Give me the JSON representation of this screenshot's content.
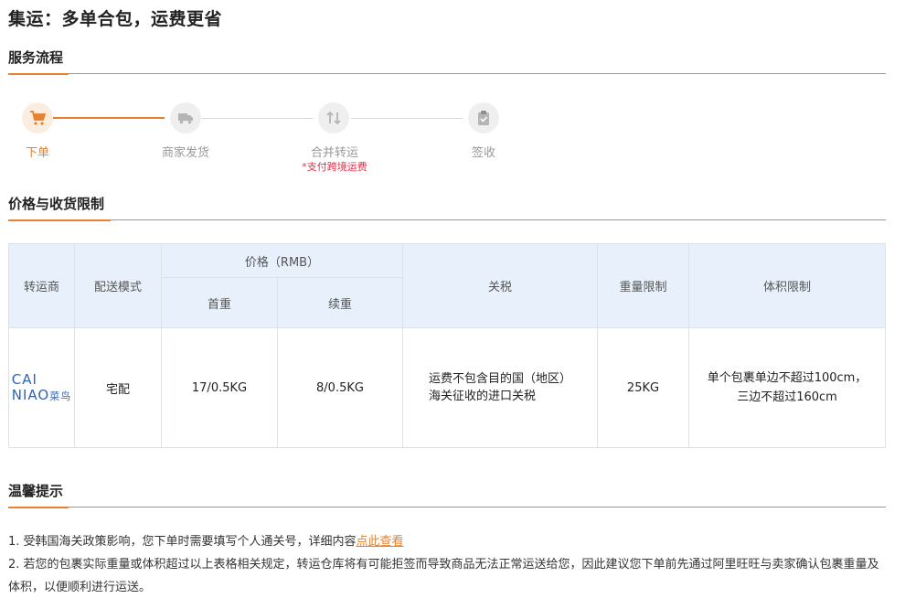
{
  "title": "集运：多单合包，运费更省",
  "sections": {
    "process": "服务流程",
    "price": "价格与收货限制",
    "tips": "温馨提示"
  },
  "steps": [
    {
      "label": "下单",
      "icon": "cart-icon",
      "active": true
    },
    {
      "label": "商家发货",
      "icon": "truck-icon",
      "active": false
    },
    {
      "label": "合并转运",
      "icon": "merge-icon",
      "active": false,
      "note": "*支付跨境运费"
    },
    {
      "label": "签收",
      "icon": "clipboard-check-icon",
      "active": false
    }
  ],
  "table": {
    "headers": {
      "carrier": "转运商",
      "mode": "配送模式",
      "price": "价格（RMB）",
      "first": "首重",
      "extra": "续重",
      "tax": "关税",
      "weight": "重量限制",
      "volume": "体积限制"
    },
    "row": {
      "carrier_logo_line1": "CAI",
      "carrier_logo_line2": "NIAO",
      "carrier_logo_cn": "菜鸟",
      "mode": "宅配",
      "first": "17/0.5KG",
      "extra": "8/0.5KG",
      "tax_line1": "运费不包含目的国（地区）",
      "tax_line2": "海关征收的进口关税",
      "weight": "25KG",
      "volume_line1": "单个包裹单边不超过100cm，",
      "volume_line2": "三边不超过160cm"
    }
  },
  "notes": {
    "n1_text": "1. 受韩国海关政策影响，您下单时需要填写个人通关号，详细内容",
    "n1_link": "点此查看",
    "n2_text": "2. 若您的包裹实际重量或体积超过以上表格相关规定，转运仓库将有可能拒签而导致商品无法正常运送给您，因此建议您下单前先通过阿里旺旺与卖家确认包裹重量及体积，以便顺利进行运送。"
  },
  "colors": {
    "accent": "#e8812f",
    "note_red": "#e0324b",
    "header_bg": "#e8f1fb"
  }
}
